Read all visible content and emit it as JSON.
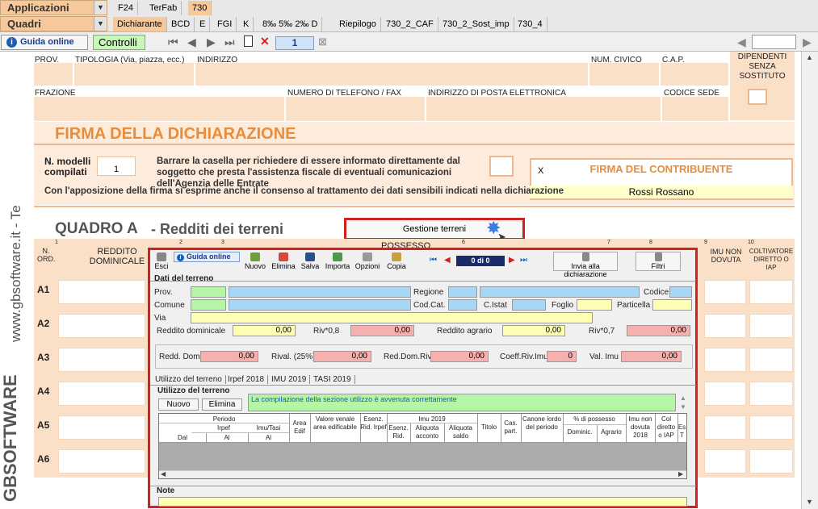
{
  "top": {
    "apps_label": "Applicazioni",
    "quadri_label": "Quadri",
    "tabs_row1": [
      "F24",
      "TerFab",
      "730"
    ],
    "tabs_row2": [
      "Dichiarante",
      "BCD",
      "E",
      "FGI",
      "K",
      "8‰ 5‰ 2‰ D",
      "Riepilogo",
      "730_2_CAF",
      "730_2_Sost_imp",
      "730_4"
    ]
  },
  "ctrl": {
    "guida_label": "Guida online",
    "controlli_label": "Controlli",
    "page_number": "1"
  },
  "side": {
    "vertical_text": "www.gbsoftware.it - Te",
    "brand": "GBSOFTWARE"
  },
  "form": {
    "row1": [
      "PROV.",
      "TIPOLOGIA (Via, piazza, ecc.)",
      "INDIRIZZO",
      "NUM. CIVICO",
      "C.A.P."
    ],
    "dip_label": "DIPENDENTI SENZA SOSTITUTO",
    "row2": [
      "FRAZIONE",
      "NUMERO DI TELEFONO / FAX",
      "INDIRIZZO DI POSTA ELETTRONICA",
      "CODICE SEDE"
    ],
    "firma_title": "FIRMA DELLA DICHIARAZIONE",
    "n_modelli_label": "N. modelli compilati",
    "n_modelli_value": "1",
    "barrare_text": "Barrare la casella per richiedere di essere informato direttamente dal soggetto che presta l'assistenza fiscale di eventuali comunicazioni dell'Agenzia delle Entrate",
    "firma_contr_label": "FIRMA DEL CONTRIBUENTE",
    "firma_x": "X",
    "firma_name": "Rossi Rossano",
    "consenso_text": "Con l'apposizione della firma si esprime anche il consenso al trattamento dei dati sensibili indicati nella dichiarazione",
    "quadro_title": "QUADRO A",
    "quadro_subtitle": "- Redditi dei terreni",
    "gestione_label": "Gestione terreni",
    "cols": {
      "nord": "N. ORD.",
      "reddito": "REDDITO DOMINICALE",
      "possesso": "POSSESSO",
      "imu": "IMU NON DOVUTA",
      "coltivatore": "COLTIVATORE DIRETTO O IAP"
    },
    "col_nums": [
      "1",
      "2",
      "3",
      "6",
      "7",
      "8",
      "9",
      "10"
    ],
    "rows": [
      "A1",
      "A2",
      "A3",
      "A4",
      "A5",
      "A6"
    ]
  },
  "dialog": {
    "toolbar": {
      "esci": "Esci",
      "guida": "Guida online",
      "nuovo": "Nuovo",
      "elimina": "Elimina",
      "salva": "Salva",
      "importa": "Importa",
      "opzioni": "Opzioni",
      "copia": "Copia",
      "counter": "0 di 0",
      "invia": "Invia alla dichiarazione",
      "filtri": "Filtri"
    },
    "dati_title": "Dati del terreno",
    "labels": {
      "prov": "Prov.",
      "regione": "Regione",
      "codice": "Codice",
      "comune": "Comune",
      "codcat": "Cod.Cat.",
      "cistat": "C.Istat",
      "foglio": "Foglio",
      "particella": "Particella",
      "via": "Via",
      "reddito_dom": "Reddito dominicale",
      "riv08": "Riv*0,8",
      "reddito_agr": "Reddito agrario",
      "riv07": "Riv*0,7",
      "redd_dom": "Redd. Dom.",
      "rival": "Rival. (25%)",
      "red_dom_riv": "Red.Dom.Riv.",
      "coeff": "Coeff.Riv.Imu",
      "val_imu": "Val. Imu"
    },
    "values": {
      "reddito_dom": "0,00",
      "riv08": "0,00",
      "reddito_agr": "0,00",
      "riv07": "0,00",
      "redd_dom": "0,00",
      "rival": "0,00",
      "red_dom_riv": "0,00",
      "coeff": "0",
      "val_imu": "0,00"
    },
    "tabs": [
      "Utilizzo del terreno",
      "Irpef 2018",
      "IMU 2019",
      "TASI 2019"
    ],
    "utilizzo_title": "Utilizzo del terreno",
    "btn_nuovo": "Nuovo",
    "btn_elimina": "Elimina",
    "message": "La compilazione della sezione utilizzo è avvenuta correttamente",
    "grid_group": {
      "periodo": "Periodo",
      "imu2019": "Imu 2019",
      "possesso": "% di possesso"
    },
    "grid_sub": {
      "irpef": "Irpef",
      "imu_tasi": "Imu/Tasi",
      "dal": "Dal",
      "al1": "Al",
      "al2": "Al"
    },
    "grid_cols": [
      "Area Edif",
      "Valore venale area edificabile",
      "Esenz. Rid. Irpef",
      "Esenz. Rid.",
      "Aliquota acconto",
      "Aliquota saldo",
      "Titolo",
      "Cas. part.",
      "Canone lordo del periodo",
      "Dominic.",
      "Agrario",
      "Imu non dovuta 2018",
      "Col diretto o IAP",
      "Es T"
    ],
    "note_label": "Note"
  },
  "colors": {
    "accent": "#e88d3a",
    "red": "#d21f1f",
    "peach": "#fbe0c8"
  }
}
